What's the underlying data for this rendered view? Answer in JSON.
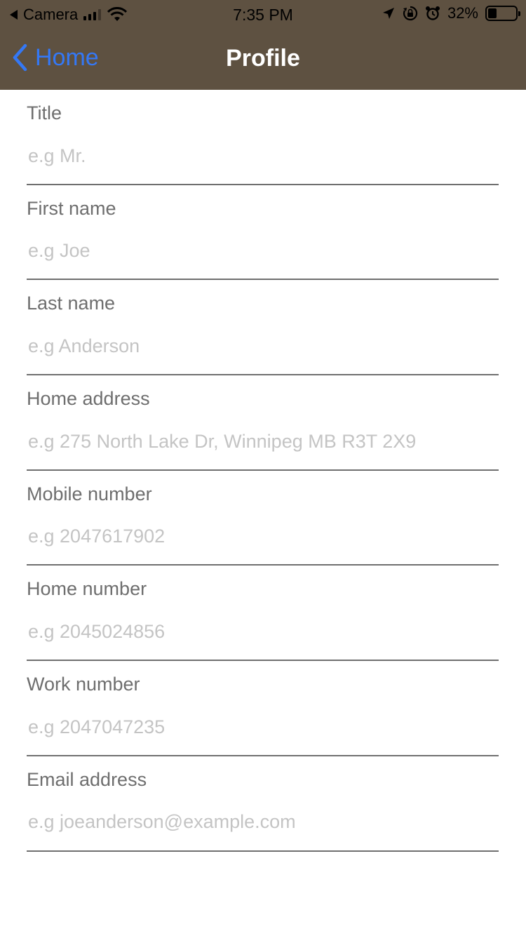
{
  "status_bar": {
    "back_app": "Camera",
    "time": "7:35 PM",
    "battery": "32%",
    "battery_level": 0.32,
    "icons": [
      "signal-icon",
      "wifi-icon",
      "location-icon",
      "orientation-lock-icon",
      "alarm-icon",
      "battery-icon"
    ]
  },
  "nav": {
    "back_label": "Home",
    "title": "Profile"
  },
  "colors": {
    "header": "#5e5141",
    "accent": "#3478f6",
    "label": "#6e6e6e",
    "placeholder": "#c4c4c4"
  },
  "fields": [
    {
      "label": "Title",
      "placeholder": "e.g Mr."
    },
    {
      "label": "First name",
      "placeholder": "e.g Joe"
    },
    {
      "label": "Last name",
      "placeholder": "e.g Anderson"
    },
    {
      "label": "Home address",
      "placeholder": "e.g 275 North Lake Dr, Winnipeg MB R3T 2X9"
    },
    {
      "label": "Mobile number",
      "placeholder": "e.g 2047617902"
    },
    {
      "label": "Home number",
      "placeholder": "e.g 2045024856"
    },
    {
      "label": "Work number",
      "placeholder": "e.g 2047047235"
    },
    {
      "label": "Email address",
      "placeholder": "e.g joeanderson@example.com"
    }
  ]
}
